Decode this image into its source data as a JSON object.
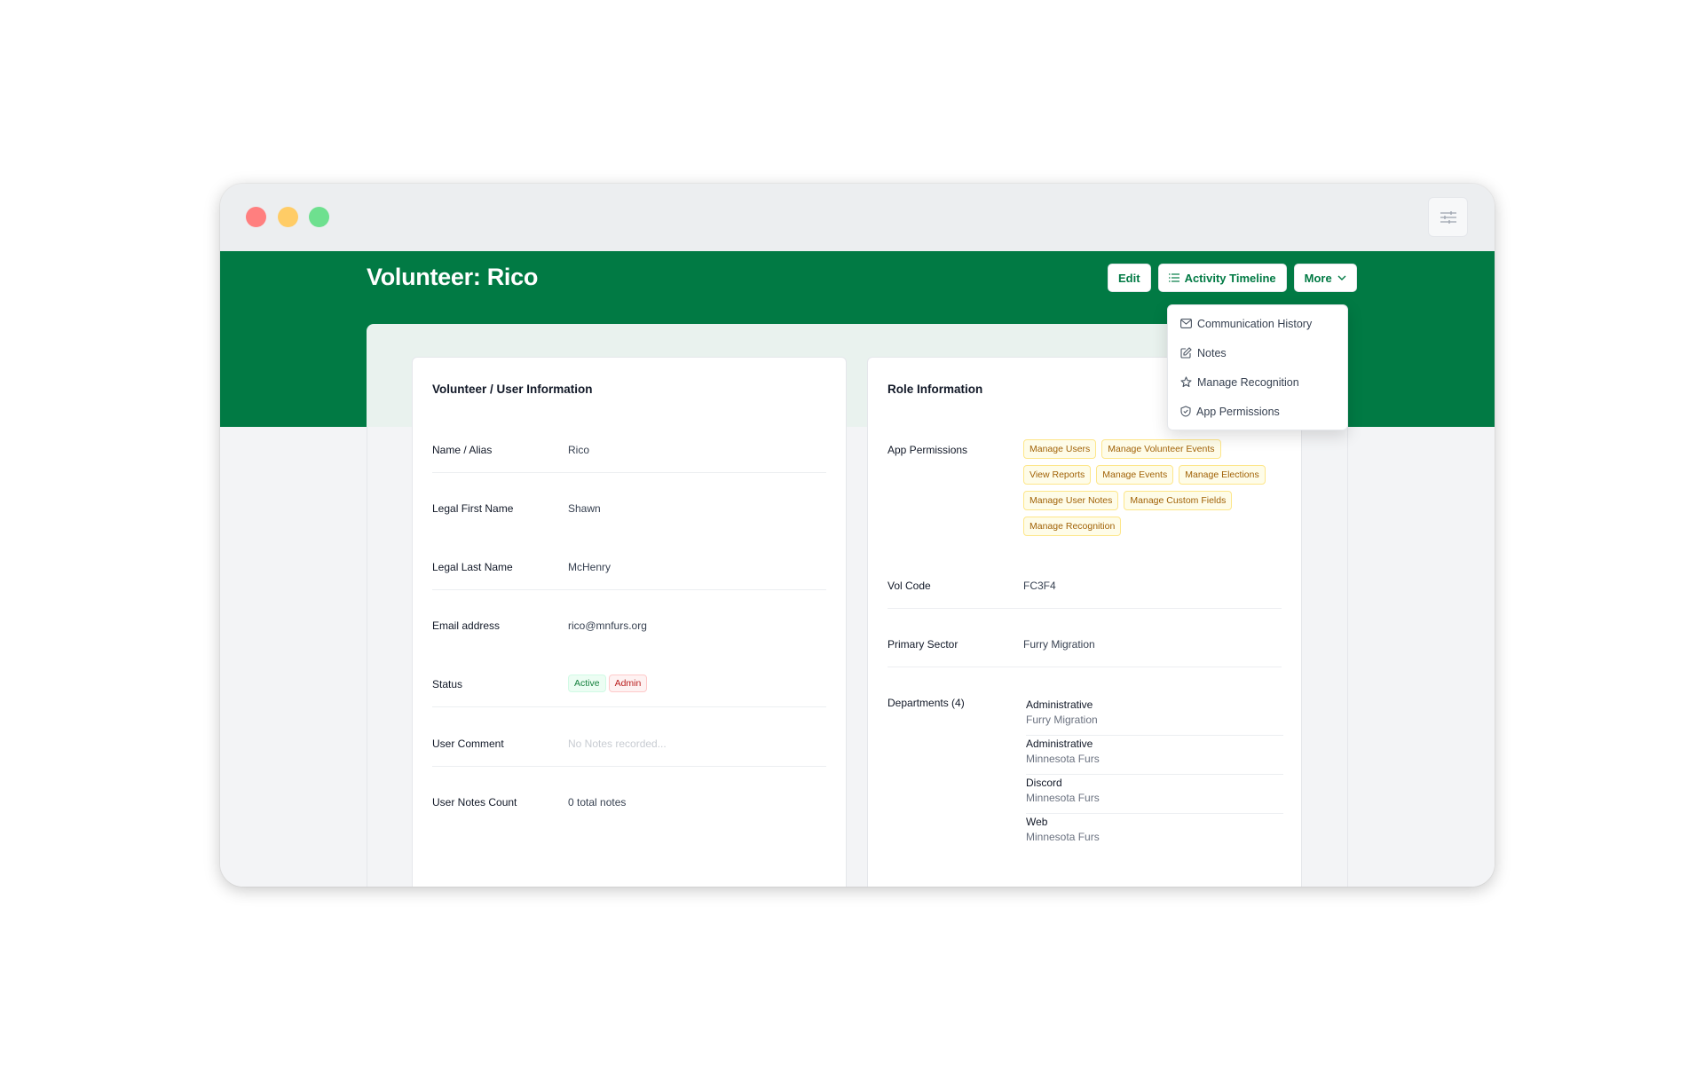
{
  "header": {
    "title": "Volunteer: Rico",
    "edit_label": "Edit",
    "timeline_label": "Activity Timeline",
    "more_label": "More"
  },
  "more_menu": {
    "items": [
      {
        "label": "Communication History",
        "icon": "envelope-icon"
      },
      {
        "label": "Notes",
        "icon": "edit-note-icon"
      },
      {
        "label": "Manage Recognition",
        "icon": "star-icon"
      },
      {
        "label": "App Permissions",
        "icon": "shield-icon"
      }
    ]
  },
  "user_info": {
    "title": "Volunteer / User Information",
    "rows": [
      {
        "label": "Name / Alias",
        "value": "Rico"
      },
      {
        "label": "Legal First Name",
        "value": "Shawn"
      },
      {
        "label": "Legal Last Name",
        "value": "McHenry"
      },
      {
        "label": "Email address",
        "value": "rico@mnfurs.org"
      },
      {
        "label": "Status",
        "badges": [
          "Active",
          "Admin"
        ]
      },
      {
        "label": "User Comment",
        "value": "No Notes recorded..."
      },
      {
        "label": "User Notes Count",
        "value": "0 total notes"
      }
    ]
  },
  "role_info": {
    "title": "Role Information",
    "permissions_label": "App Permissions",
    "permissions": [
      "Manage Users",
      "Manage Volunteer Events",
      "View Reports",
      "Manage Events",
      "Manage Elections",
      "Manage User Notes",
      "Manage Custom Fields",
      "Manage Recognition"
    ],
    "vol_code_label": "Vol Code",
    "vol_code": "FC3F4",
    "primary_sector_label": "Primary Sector",
    "primary_sector": "Furry Migration",
    "departments_label": "Departments (4)",
    "departments": [
      {
        "name": "Administrative",
        "org": "Furry Migration"
      },
      {
        "name": "Administrative",
        "org": "Minnesota Furs"
      },
      {
        "name": "Discord",
        "org": "Minnesota Furs"
      },
      {
        "name": "Web",
        "org": "Minnesota Furs"
      }
    ]
  }
}
